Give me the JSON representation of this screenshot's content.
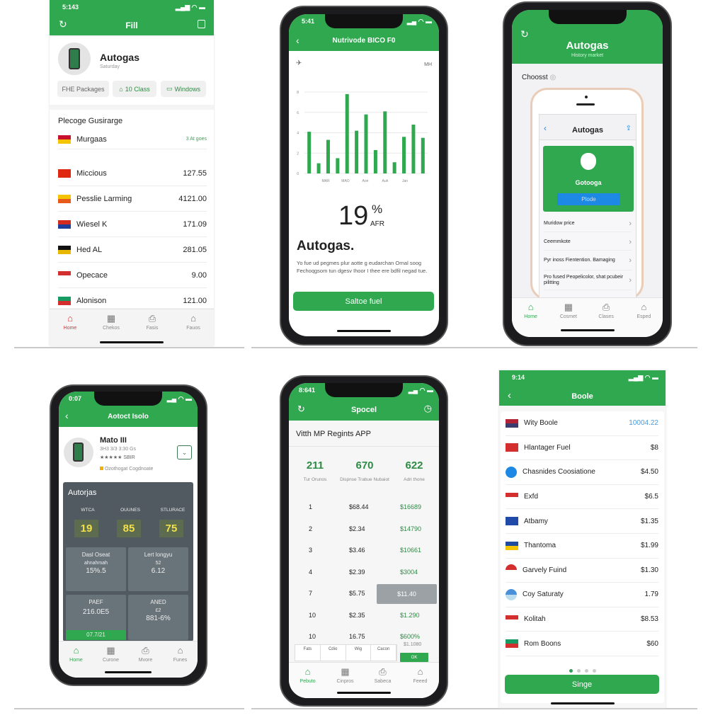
{
  "colors": {
    "brand_green": "#2fa84f",
    "dark_card": "#505a60",
    "blue": "#1e88e5",
    "red": "#d33"
  },
  "panel1": {
    "status_time": "5:143",
    "header_title": "Fill",
    "profile": {
      "name": "Autogas",
      "subtitle": "Saturday"
    },
    "chips": [
      "FHE Packages",
      "10 Class",
      "Windows"
    ],
    "section_title": "Plecoge Gusirarge",
    "rows": [
      {
        "name": "Murgaas",
        "value": "3 At goes",
        "flag": [
          "#c8102e",
          "#f5c400"
        ]
      },
      {
        "name": "Miccious",
        "value": "127.55",
        "flag": [
          "#de2910",
          "#de2910"
        ]
      },
      {
        "name": "Pesslie Larming",
        "value": "4121.00",
        "flag": [
          "#f5c400",
          "#e85a1c"
        ]
      },
      {
        "name": "Wiesel K",
        "value": "171.09",
        "flag": [
          "#d52b1e",
          "#1f3e9c"
        ]
      },
      {
        "name": "Hed AL",
        "value": "281.05",
        "flag": [
          "#111",
          "#e8b800"
        ]
      },
      {
        "name": "Opecace",
        "value": "9.00",
        "flag": [
          "#d32f2f",
          "#fff"
        ]
      },
      {
        "name": "Alonison",
        "value": "121.00",
        "flag": [
          "#169b62",
          "#d32f2f"
        ]
      }
    ],
    "tabs": [
      {
        "label": "Home",
        "icon": "home-icon"
      },
      {
        "label": "Chekos",
        "icon": "calculator-icon"
      },
      {
        "label": "Fasis",
        "icon": "share-icon"
      },
      {
        "label": "Fauos",
        "icon": "house-outline-icon"
      }
    ]
  },
  "panel2": {
    "status_time": "5:41",
    "header_title": "Nutrivode BICO F0",
    "corner_label": "MH",
    "big_value": "19",
    "big_unit": "%",
    "big_sub": "AFR",
    "title": "Autogas.",
    "description": "Yo fue ud pegmes plur aotte g eudarchan Ornal soog Fechoqgsom tun dgesv Ihoor I thee ere bdfil negad tue.",
    "button": "Saltoe fuel"
  },
  "chart_data": {
    "type": "bar",
    "values": [
      4.1,
      1.0,
      3.3,
      1.5,
      7.8,
      4.2,
      5.8,
      2.3,
      6.1,
      1.1,
      3.6,
      4.8,
      3.5
    ],
    "ylim": [
      0,
      8
    ],
    "yticks": [
      "0",
      "2",
      "4",
      "6",
      "8"
    ],
    "xticks": [
      "MAR",
      "MAO",
      "Aon",
      "Auh",
      "Jan"
    ],
    "grid": true,
    "color": "#2fa84f"
  },
  "panel3": {
    "header_title": "Autogas",
    "header_subtitle": "History market",
    "section_label": "Choosst",
    "inner": {
      "nav_title": "Autogas",
      "card_title": "Gotooga",
      "card_button": "Plode",
      "rows": [
        "Muridow price",
        "Ceemmkote",
        "Pyr inoss Fientention. Bamaging",
        "Pro fused Peopelicolor, shat pcubeir pilitting"
      ]
    },
    "tabs": [
      {
        "label": "Home",
        "icon": "home-icon"
      },
      {
        "label": "Cosmet",
        "icon": "calculator-icon"
      },
      {
        "label": "Clases",
        "icon": "share-icon"
      },
      {
        "label": "Esped",
        "icon": "house-outline-icon"
      }
    ]
  },
  "panel4": {
    "status_time": "0:07",
    "header_title": "Aotoct Isolo",
    "profile": {
      "name": "Mato III",
      "line": "3H3 3/3 3:30 Gs",
      "rating": "4.5",
      "rating_text": "SBIR",
      "badge": "Ozothogat Cogdnoate"
    },
    "card_title": "Autorjas",
    "metrics": [
      {
        "label": "WTCA",
        "value": "19"
      },
      {
        "label": "OUUNES",
        "value": "85"
      },
      {
        "label": "STLURACE",
        "value": "75"
      }
    ],
    "cells": [
      {
        "title": "Dasl Oseat",
        "value": "15%.5",
        "sub": "ahnahmah"
      },
      {
        "title": "Lert longyu",
        "value": "6.12",
        "sub": "52"
      },
      {
        "title": "PAEF",
        "value": "216.0E5",
        "sub": "",
        "bar": "07.7/21"
      },
      {
        "title": "ANED",
        "value": "881-6%",
        "sub": "£2"
      }
    ],
    "tabs": [
      {
        "label": "Home",
        "icon": "home-icon"
      },
      {
        "label": "Curone",
        "icon": "calculator-icon"
      },
      {
        "label": "Mvore",
        "icon": "share-icon"
      },
      {
        "label": "Funes",
        "icon": "house-outline-icon"
      }
    ]
  },
  "panel5": {
    "status_time": "8:641",
    "header_title": "Spocel",
    "title": "Vitth MP Regints APP",
    "stats": [
      {
        "value": "211",
        "label": "Tur Orunos"
      },
      {
        "value": "670",
        "label": "Dispnse Trabue Nubaiot"
      },
      {
        "value": "622",
        "label": "Adri thone"
      }
    ],
    "rows": [
      {
        "n": "1",
        "price": "$68.44",
        "total": "$16689"
      },
      {
        "n": "2",
        "price": "$2.34",
        "total": "$14790"
      },
      {
        "n": "3",
        "price": "$3.46",
        "total": "$10661"
      },
      {
        "n": "4",
        "price": "$2.39",
        "total": "$3004"
      },
      {
        "n": "7",
        "price": "$5.75",
        "total": "$11.40",
        "highlight": true
      },
      {
        "n": "10",
        "price": "$2.35",
        "total": "$1.290"
      },
      {
        "n": "10",
        "price": "16.75",
        "total": "$600%"
      }
    ],
    "mini_table": [
      "Fats",
      "Cdio",
      "Wig",
      "Cacon"
    ],
    "mini_value": "$1.1080",
    "mini_button": "OK",
    "tabs": [
      {
        "label": "Pebuto",
        "icon": "home-icon"
      },
      {
        "label": "Cinpros",
        "icon": "calculator-icon"
      },
      {
        "label": "Sabeca",
        "icon": "share-icon"
      },
      {
        "label": "Feeed",
        "icon": "house-outline-icon"
      }
    ]
  },
  "panel6": {
    "status_time": "9:14",
    "header_title": "Boole",
    "rows": [
      {
        "name": "Wity Boole",
        "value": "10004.22",
        "blue": true,
        "flag": [
          "#b22234",
          "#3c3b6e"
        ]
      },
      {
        "name": "Hlantager Fuel",
        "value": "$8",
        "flag": [
          "#d32f2f",
          "#d32f2f"
        ]
      },
      {
        "name": "Chasnides Coosiatione",
        "value": "$4.50",
        "flag": [
          "#1e88e5",
          "#1e88e5"
        ],
        "round": true
      },
      {
        "name": "Exfd",
        "value": "$6.5",
        "flag": [
          "#d32f2f",
          "#fff"
        ]
      },
      {
        "name": "Atbamy",
        "value": "$1.35",
        "flag": [
          "#1f4aa8",
          "#1f4aa8"
        ]
      },
      {
        "name": "Thantoma",
        "value": "$1.99",
        "flag": [
          "#1e4aa0",
          "#f5c400"
        ]
      },
      {
        "name": "Garvely Fuind",
        "value": "$1.30",
        "flag": [
          "#d32f2f",
          "#fff"
        ],
        "round": true
      },
      {
        "name": "Coy Saturaty",
        "value": "1.79",
        "flag": [
          "#4a90d9",
          "#bde"
        ],
        "round": true
      },
      {
        "name": "Kolitah",
        "value": "$8.53",
        "flag": [
          "#d32f2f",
          "#fff"
        ]
      },
      {
        "name": "Rom Boons",
        "value": "$60",
        "flag": [
          "#169b62",
          "#d32f2f"
        ]
      }
    ],
    "page_dots": 4,
    "page_active": 1,
    "button": "Singe"
  }
}
